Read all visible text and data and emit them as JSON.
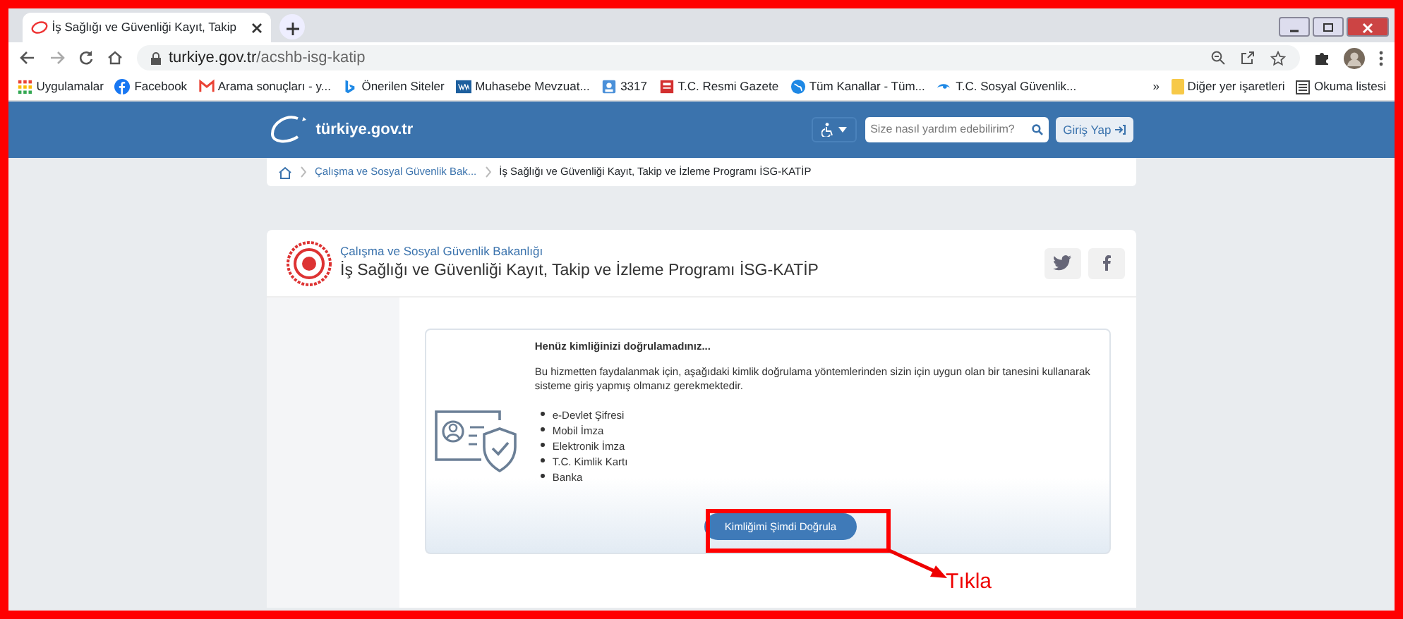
{
  "browser": {
    "tab_title": "İş Sağlığı ve Güvenliği Kayıt, Takip",
    "url_host": "turkiye.gov.tr",
    "url_path": "/acshb-isg-katip",
    "bookmarks": [
      "Uygulamalar",
      "Facebook",
      "Arama sonuçları - y...",
      "Önerilen Siteler",
      "Muhasebe Mevzuat...",
      "3317",
      "T.C. Resmi Gazete",
      "Tüm Kanallar - Tüm...",
      "T.C. Sosyal Güvenlik..."
    ],
    "overflow": "»",
    "other_bookmarks": "Diğer yer işaretleri",
    "reading_list": "Okuma listesi"
  },
  "header": {
    "logo": "türkiye.gov.tr",
    "search_placeholder": "Size nasıl yardım edebilirim?",
    "login": "Giriş Yap"
  },
  "breadcrumb": [
    "Çalışma ve Sosyal Güvenlik Bak...",
    "İş Sağlığı ve Güvenliği Kayıt, Takip ve İzleme Programı İSG-KATİP"
  ],
  "card": {
    "ministry": "Çalışma ve Sosyal Güvenlik Bakanlığı",
    "title": "İş Sağlığı ve Güvenliği Kayıt, Takip ve İzleme Programı İSG-KATİP",
    "notice_title": "Henüz kimliğinizi doğrulamadınız...",
    "notice_text": "Bu hizmetten faydalanmak için, aşağıdaki kimlik doğrulama yöntemlerinden sizin için uygun olan bir tanesini kullanarak sisteme giriş yapmış olmanız gerekmektedir.",
    "methods": [
      "e-Devlet Şifresi",
      "Mobil İmza",
      "Elektronik İmza",
      "T.C. Kimlik Kartı",
      "Banka"
    ],
    "verify_button": "Kimliğimi Şimdi Doğrula"
  },
  "annotation": {
    "label": "Tıkla"
  }
}
